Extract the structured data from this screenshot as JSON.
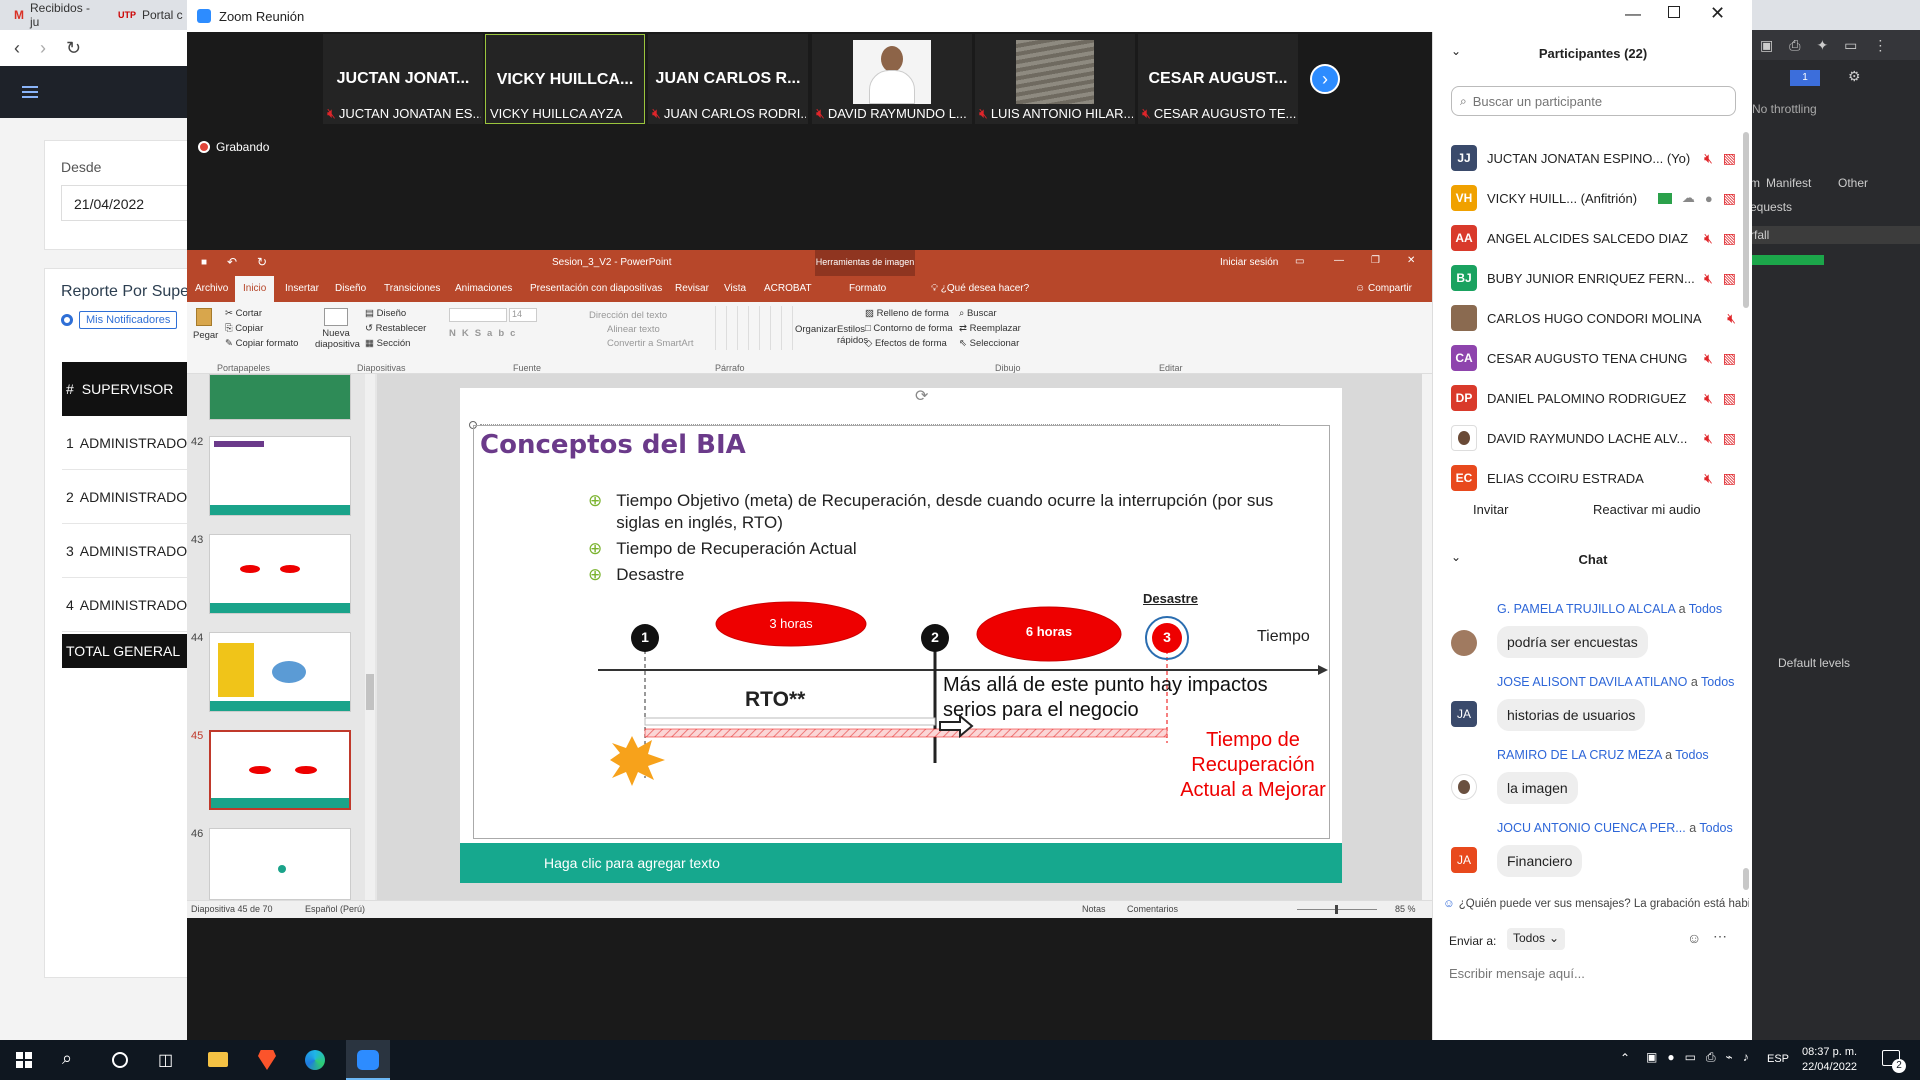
{
  "browser": {
    "tabs": [
      "Recibidos - ju",
      "Portal c"
    ]
  },
  "app": {
    "desde_label": "Desde",
    "desde_value": "21/04/2022",
    "reporte_title": "Reporte Por Supe",
    "mis_notificaciones": "Mis Notificadores",
    "table_header_num": "#",
    "table_header_supervisor": "SUPERVISOR",
    "rows": [
      {
        "num": "1",
        "name": "ADMINISTRADOR"
      },
      {
        "num": "2",
        "name": "ADMINISTRADOR"
      },
      {
        "num": "3",
        "name": "ADMINISTRADOR"
      },
      {
        "num": "4",
        "name": "ADMINISTRADOR"
      }
    ],
    "total": "TOTAL GENERAL"
  },
  "devtools": {
    "throttling": "No throttling",
    "tabs": [
      "m",
      "Manifest",
      "Other"
    ],
    "requests": "equests",
    "waterfall": "rfall",
    "levels": "Default levels"
  },
  "zoom": {
    "window_title": "Zoom Reunión",
    "recording": "Grabando",
    "videos": [
      {
        "name": "JUCTAN JONAT...",
        "label": "JUCTAN JONATAN ES...",
        "muted": true
      },
      {
        "name": "VICKY HUILLCA...",
        "label": "VICKY HUILLCA AYZA",
        "muted": false
      },
      {
        "name": "JUAN CARLOS R...",
        "label": "JUAN CARLOS RODRI...",
        "muted": true
      },
      {
        "name": "",
        "label": "DAVID RAYMUNDO L...",
        "muted": true
      },
      {
        "name": "",
        "label": "LUIS ANTONIO HILAR...",
        "muted": true
      },
      {
        "name": "CESAR AUGUST...",
        "label": "CESAR AUGUSTO TE...",
        "muted": true
      }
    ],
    "participants_title": "Participantes (22)",
    "search_placeholder": "Buscar un participante",
    "participants": [
      {
        "initials": "JJ",
        "name": "JUCTAN JONATAN ESPINO... (Yo)",
        "color": "#3a4a6b"
      },
      {
        "initials": "VH",
        "name": "VICKY HUILL... (Anfitrión)",
        "color": "#f0a100"
      },
      {
        "initials": "AA",
        "name": "ANGEL ALCIDES SALCEDO DIAZ",
        "color": "#d93a2b"
      },
      {
        "initials": "BJ",
        "name": "BUBY JUNIOR ENRIQUEZ FERN...",
        "color": "#1aa260"
      },
      {
        "initials": "",
        "name": "CARLOS HUGO CONDORI MOLINA",
        "color": "#8a6a50"
      },
      {
        "initials": "CA",
        "name": "CESAR AUGUSTO TENA CHUNG",
        "color": "#8e44ad"
      },
      {
        "initials": "DP",
        "name": "DANIEL PALOMINO RODRIGUEZ",
        "color": "#d93a2b"
      },
      {
        "initials": "",
        "name": "DAVID RAYMUNDO LACHE ALV...",
        "color": "#555"
      },
      {
        "initials": "EC",
        "name": "ELIAS CCOIRU ESTRADA",
        "color": "#e8491d"
      }
    ],
    "invite": "Invitar",
    "reactivate": "Reactivar mi audio",
    "chat_title": "Chat",
    "chat": [
      {
        "from": "G. PAMELA TRUJILLO ALCALA",
        "to": "Todos",
        "text": "podría ser encuestas",
        "initials": "",
        "color": "#a07a60"
      },
      {
        "from": "JOSE ALISONT DAVILA ATILANO",
        "to": "Todos",
        "text": "historias de usuarios",
        "initials": "JA",
        "color": "#3a4a6b"
      },
      {
        "from": "RAMIRO DE LA CRUZ MEZA",
        "to": "Todos",
        "text": "la imagen",
        "initials": "",
        "color": "#6a5040"
      },
      {
        "from": "JOCU ANTONIO CUENCA PER...",
        "to": "Todos",
        "text": "Financiero",
        "initials": "JA",
        "color": "#e8491d"
      }
    ],
    "a_word": "a",
    "notice": "¿Quién puede ver sus mensajes? La grabación está habilit",
    "send_to_label": "Enviar a:",
    "send_to_value": "Todos",
    "message_placeholder": "Escribir mensaje aquí..."
  },
  "ppt": {
    "title": "Sesion_3_V2 - PowerPoint",
    "tools": "Herramientas de imagen",
    "signin": "Iniciar sesión",
    "tabs": [
      "Archivo",
      "Inicio",
      "Insertar",
      "Diseño",
      "Transiciones",
      "Animaciones",
      "Presentación con diapositivas",
      "Revisar",
      "Vista",
      "ACROBAT",
      "Formato"
    ],
    "tell_me": "¿Qué desea hacer?",
    "share": "Compartir",
    "ribbon": {
      "pegar": "Pegar",
      "cortar": "Cortar",
      "copiar": "Copiar",
      "copiar_formato": "Copiar formato",
      "nueva": "Nueva diapositiva",
      "diseno": "Diseño",
      "restablecer": "Restablecer",
      "seccion": "Sección",
      "font_size": "14",
      "direccion": "Dirección del texto",
      "alinear": "Alinear texto",
      "convertir": "Convertir a SmartArt",
      "organizar": "Organizar",
      "estilos": "Estilos rápidos",
      "relleno": "Relleno de forma",
      "contorno": "Contorno de forma",
      "efectos": "Efectos de forma",
      "buscar": "Buscar",
      "reemplazar": "Reemplazar",
      "seleccionar": "Seleccionar",
      "groups": [
        "Portapapeles",
        "Diapositivas",
        "Fuente",
        "Párrafo",
        "Dibujo",
        "Editar"
      ]
    },
    "slide_numbers": [
      "42",
      "43",
      "44",
      "45",
      "46"
    ],
    "status_slide": "Diapositiva 45 de 70",
    "status_lang": "Español (Perú)",
    "notes": "Notas",
    "comments": "Comentarios",
    "zoom": "85 %",
    "slide": {
      "title": "Conceptos del BIA",
      "bullets": [
        "Tiempo Objetivo (meta) de Recuperación, desde cuando ocurre la interrupción (por sus siglas en inglés, RTO)",
        "Tiempo de Recuperación Actual",
        "Desastre"
      ],
      "desastre_label": "Desastre",
      "tiempo": "Tiempo",
      "hours1": "3 horas",
      "hours2": "6 horas",
      "n1": "1",
      "n2": "2",
      "n3": "3",
      "rto": "RTO**",
      "impact": "Más allá de este punto hay impactos serios para el negocio",
      "red_text": "Tiempo de Recuperación Actual a Mejorar",
      "footer": "Haga clic para agregar texto"
    }
  },
  "taskbar": {
    "lang": "ESP",
    "time": "08:37 p. m.",
    "date": "22/04/2022",
    "badge": "2"
  }
}
